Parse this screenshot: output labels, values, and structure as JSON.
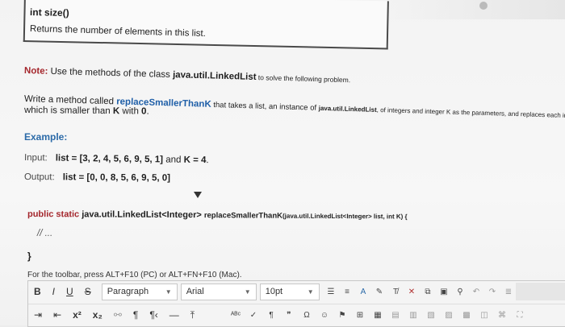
{
  "method": {
    "signature": "int size()",
    "description": "Returns the number of elements in this list."
  },
  "note": {
    "label": "Note:",
    "text_before": " Use the methods of the class ",
    "class_name": "java.util.LinkedList",
    "text_after": " to solve the following problem."
  },
  "problem": {
    "line1_prefix": "Write a method called ",
    "method_name": "replaceSmallerThanK",
    "line1_middle": " that takes a list, an instance of ",
    "line1_class": "java.util.LinkedList",
    "line1_rest": ", of integers and integer K as the parameters, and replaces each integer in the list",
    "line2_prefix": "which is smaller than ",
    "line2_k": "K",
    "line2_mid": " with ",
    "line2_zero": "0",
    "line2_end": "."
  },
  "example": {
    "heading": "Example:",
    "input_label": "Input:",
    "input_list": "list = [3, 2, 4, 5, 6, 9, 5, 1]",
    "input_and": " and ",
    "input_k": "K = 4",
    "input_end": ".",
    "output_label": "Output:",
    "output_list": "list = [0, 0, 8, 5, 6, 9, 5, 0]"
  },
  "code": {
    "keywords": "public static",
    "return_type": " java.util.LinkedList<Integer> ",
    "name": "replaceSmallerThanK",
    "params": "(java.util.LinkedList<Integer> list, int K) {",
    "comment": "// ...",
    "close": "}"
  },
  "editor": {
    "hint": "For the toolbar, press ALT+F10 (PC) or ALT+FN+F10 (Mac).",
    "bold": "B",
    "italic": "I",
    "underline": "U",
    "strike": "S",
    "paragraph": "Paragraph",
    "font": "Arial",
    "size": "10pt",
    "superscript": "x²",
    "subscript": "x₂",
    "pilcrow": "¶",
    "pilcrow_rtl": "¶‹",
    "hr": "—",
    "omega": "Ω",
    "quote": "❞"
  }
}
